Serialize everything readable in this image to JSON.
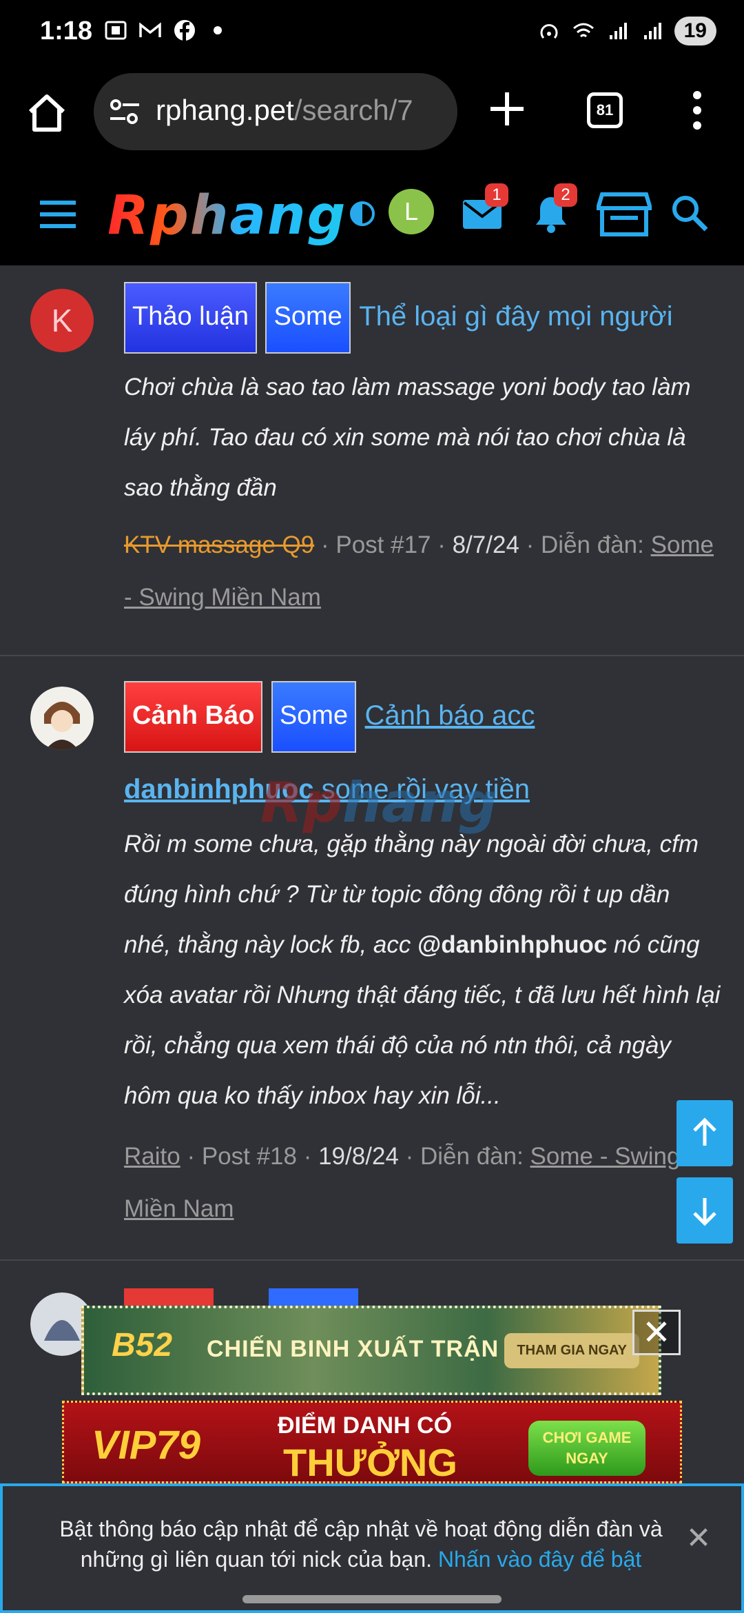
{
  "status_bar": {
    "time": "1:18",
    "battery": "19"
  },
  "browser": {
    "url_host": "rphang.pet",
    "url_path": "/search/7",
    "tab_count": "81"
  },
  "site_header": {
    "logo_text": "Rphang",
    "avatar_letter": "L",
    "messages_badge": "1",
    "alerts_badge": "2"
  },
  "posts": [
    {
      "avatar_letter": "K",
      "tags": [
        "Thảo luận",
        "Some"
      ],
      "title": "Thể loại gì đây mọi người",
      "snippet": "Chơi chùa là sao tao làm massage yoni body tao làm láy phí. Tao đau có xin some mà nói tao chơi chùa là sao thằng đần",
      "author": "KTV massage Q9",
      "post_no": "Post #17",
      "date": "8/7/24",
      "forum_label": "Diễn đàn:",
      "forum": "Some - Swing Miền Nam"
    },
    {
      "tags": [
        "Cảnh Báo",
        "Some"
      ],
      "title_part1": "Cảnh báo acc",
      "title_bold": "danbinhphuoc",
      "title_part2": " some rồi vay tiền",
      "snippet_a": "Rồi m some chưa, gặp thằng này ngoài đời chưa, cfm đúng hình chứ ? Từ từ topic đông đông rồi t up dần nhé, thằng này lock fb, acc ",
      "snippet_mention": "@danbinhphuoc",
      "snippet_b": " nó cũng xóa avatar rồi Nhưng thật đáng tiếc, t đã lưu hết hình lại rồi, chẳng qua xem thái độ của nó ntn thôi, cả ngày hôm qua ko thấy inbox hay xin lỗi...",
      "author": "Raito",
      "post_no": "Post #18",
      "date": "19/8/24",
      "forum_label": "Diễn đàn:",
      "forum": "Some - Swing Miền Nam"
    }
  ],
  "watermark": {
    "part1": "Rp",
    "part2": "hang"
  },
  "ads": {
    "ad1": {
      "logo": "B52",
      "text": "CHIẾN BINH XUẤT TRẬN",
      "button": "THAM GIA NGAY"
    },
    "ad2": {
      "logo": "VIP79",
      "top": "ĐIỂM DANH CÓ",
      "big": "THƯỞNG",
      "button": "CHƠI GAME NGAY"
    }
  },
  "notice": {
    "text": "Bật thông báo cập nhật để cập nhật về hoạt động diễn đàn và những gì liên quan tới nick của bạn. ",
    "link": "Nhấn vào đây để bật"
  },
  "colors": {
    "accent": "#29a9ec",
    "background": "#2f3136",
    "link": "#5ab4f0"
  }
}
